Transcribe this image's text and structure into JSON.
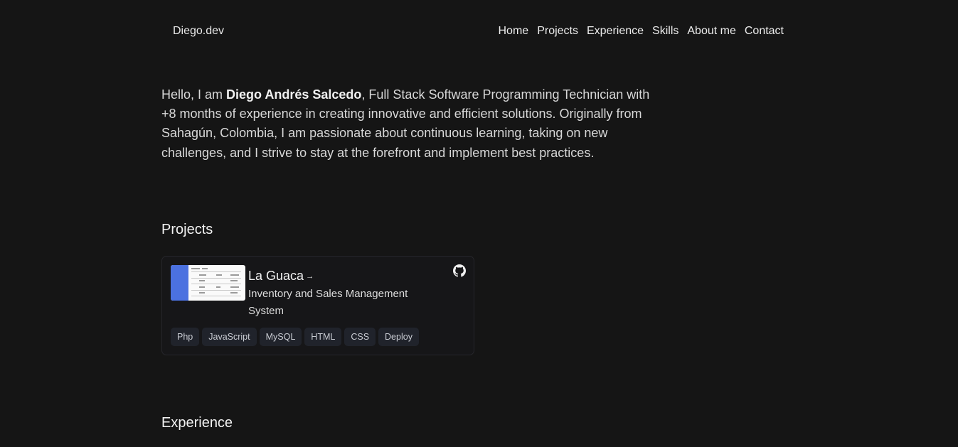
{
  "header": {
    "logo": "Diego.dev",
    "nav": [
      "Home",
      "Projects",
      "Experience",
      "Skills",
      "About me",
      "Contact"
    ]
  },
  "intro": {
    "prefix": "Hello, I am ",
    "name": "Diego Andrés Salcedo",
    "text": ", Full Stack Software Programming Technician with +8 months of experience in creating innovative and efficient solutions. Originally from Sahagún, Colombia, I am passionate about continuous learning, taking on new challenges, and I strive to stay at the forefront and implement best practices."
  },
  "projects": {
    "title": "Projects",
    "items": [
      {
        "name": "La Guaca",
        "arrow": "→",
        "description": "Inventory and Sales Management System",
        "github_icon": "github-icon",
        "tags": [
          "Php",
          "JavaScript",
          "MySQL",
          "HTML",
          "CSS",
          "Deploy"
        ]
      }
    ]
  },
  "experience": {
    "title": "Experience"
  }
}
